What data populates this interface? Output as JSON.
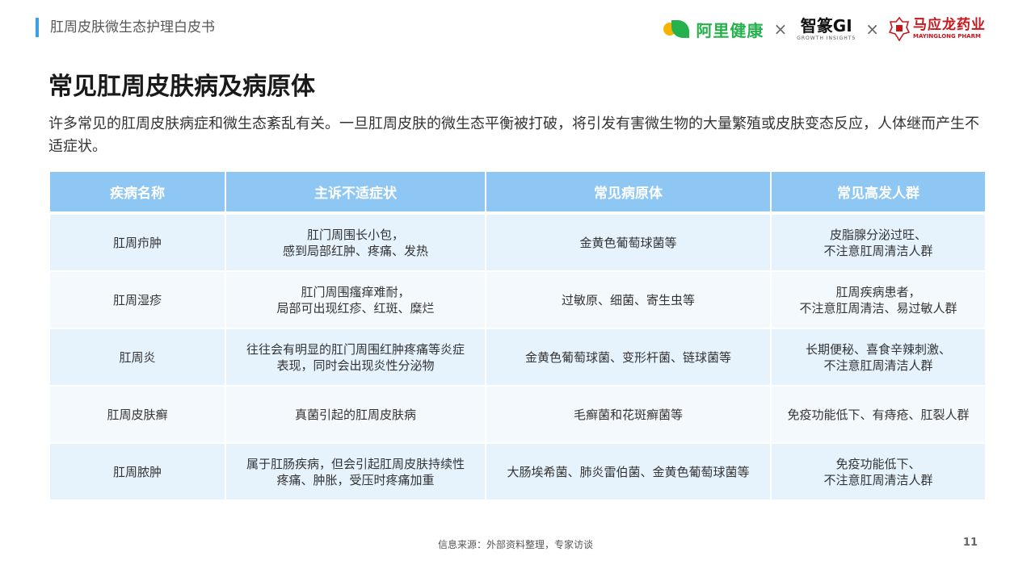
{
  "header": {
    "title": "肛周皮肤微生态护理白皮书",
    "logos": {
      "alihealth": "阿里健康",
      "separator": "×",
      "gi_main": "智篆GI",
      "gi_sub": "GROWTH  INSIGHTS",
      "myl_cn": "马应龙药业",
      "myl_en": "MAYINGLONG PHARM"
    }
  },
  "page": {
    "title": "常见肛周皮肤病及病原体",
    "intro": "许多常见的肛周皮肤病症和微生态紊乱有关。一旦肛周皮肤的微生态平衡被打破，将引发有害微生物的大量繁殖或皮肤变态反应，人体继而产生不适症状。"
  },
  "table": {
    "headers": [
      "疾病名称",
      "主诉不适症状",
      "常见病原体",
      "常见高发人群"
    ],
    "rows": [
      {
        "name": "肛周疖肿",
        "symptom": [
          "肛门周围长小包，",
          "感到局部红肿、疼痛、发热"
        ],
        "pathogen": [
          "金黄色葡萄球菌等"
        ],
        "group": [
          "皮脂腺分泌过旺、",
          "不注意肛周清洁人群"
        ]
      },
      {
        "name": "肛周湿疹",
        "symptom": [
          "肛门周围瘙痒难耐，",
          "局部可出现红疹、红斑、糜烂"
        ],
        "pathogen": [
          "过敏原、细菌、寄生虫等"
        ],
        "group": [
          "肛周疾病患者，",
          "不注意肛周清洁、易过敏人群"
        ]
      },
      {
        "name": "肛周炎",
        "symptom": [
          "往往会有明显的肛门周围红肿疼痛等炎症",
          "表现，同时会出现炎性分泌物"
        ],
        "pathogen": [
          "金黄色葡萄球菌、变形杆菌、链球菌等"
        ],
        "group": [
          "长期便秘、喜食辛辣刺激、",
          "不注意肛周清洁人群"
        ]
      },
      {
        "name": "肛周皮肤癣",
        "symptom": [
          "真菌引起的肛周皮肤病"
        ],
        "pathogen": [
          "毛癣菌和花斑癣菌等"
        ],
        "group": [
          "免疫功能低下、有痔疮、肛裂人群"
        ]
      },
      {
        "name": "肛周脓肿",
        "symptom": [
          "属于肛肠疾病，但会引起肛周皮肤持续性",
          "疼痛、肿胀，受压时疼痛加重"
        ],
        "pathogen": [
          "大肠埃希菌、肺炎雷伯菌、金黄色葡萄球菌等"
        ],
        "group": [
          "免疫功能低下、",
          "不注意肛周清洁人群"
        ]
      }
    ]
  },
  "footer": {
    "source": "信息来源：外部资料整理，专家访谈",
    "page_number": "11"
  },
  "colors": {
    "accent": "#3aa0e8",
    "table_header": "#8fc7f4",
    "row_odd": "#e6f3fd",
    "row_even": "#f4f9fe"
  }
}
